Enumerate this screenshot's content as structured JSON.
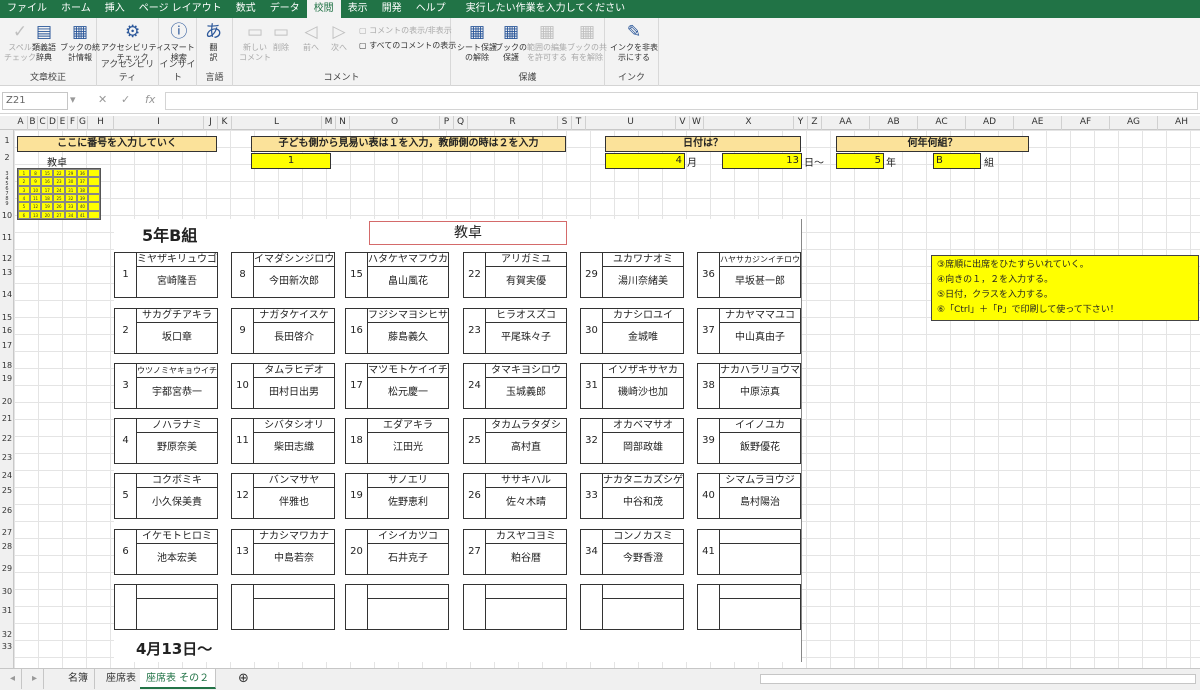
{
  "ribbon_tabs": [
    "ファイル",
    "ホーム",
    "挿入",
    "ページ レイアウト",
    "数式",
    "データ",
    "校閲",
    "表示",
    "開発",
    "ヘルプ",
    "実行したい作業を入力してください"
  ],
  "active_tab": "校閲",
  "groups": {
    "proofing": {
      "label": "文章校正",
      "spell": "スペル\nチェック",
      "thesaurus": "類義語\n辞典",
      "stats": "ブックの統\n計情報"
    },
    "accessibility": {
      "label": "アクセシビリティ",
      "check": "アクセシビリティ\nチェック"
    },
    "insights": {
      "label": "インサイト",
      "smart": "スマート\n検索"
    },
    "language": {
      "label": "言語",
      "translate": "翻\n訳"
    },
    "comments": {
      "label": "コメント",
      "new": "新しい\nコメント",
      "delete": "削除",
      "prev": "前へ",
      "next": "次へ",
      "show_hide": "コメントの表示/非表示",
      "show_all": "すべてのコメントの表示"
    },
    "protect": {
      "label": "保護",
      "unprotect_sheet": "シート保護\nの解除",
      "protect_book": "ブックの\n保護",
      "allow_edit": "範囲の編集\nを許可する",
      "unshare": "ブックの共\n有を解除"
    },
    "ink": {
      "label": "インク",
      "hide_ink": "インクを非表\n示にする"
    }
  },
  "namebox": "Z21",
  "columns": [
    "A",
    "B",
    "C",
    "D",
    "E",
    "F",
    "G",
    "H",
    "I",
    "J",
    "K",
    "L",
    "M",
    "N",
    "O",
    "P",
    "Q",
    "R",
    "S",
    "T",
    "U",
    "V",
    "W",
    "X",
    "Y",
    "Z",
    "AA",
    "AB",
    "AC",
    "AD",
    "AE",
    "AF",
    "AG",
    "AH"
  ],
  "rows": [
    "1",
    "2",
    "3",
    "4",
    "5",
    "6",
    "7",
    "8",
    "9",
    "10",
    "11",
    "12",
    "13",
    "14",
    "15",
    "16",
    "17",
    "18",
    "19",
    "20",
    "21",
    "22",
    "23",
    "24",
    "25",
    "26",
    "27",
    "28",
    "29",
    "30",
    "31",
    "32",
    "33"
  ],
  "header_bars": {
    "input_number": "ここに番号を入力していく",
    "view_side": "子ども側から見易い表は１を入力，教師側の時は２を入力",
    "date_q": "日付は？",
    "class_q": "何年何組？"
  },
  "values": {
    "view_side": "1",
    "month": "4",
    "month_unit": "月",
    "day": "13",
    "day_unit": "日～",
    "grade": "5",
    "grade_unit": "年",
    "class": "B",
    "class_unit": "組",
    "teacher_small": "教卓"
  },
  "mini_table": [
    "1",
    "8",
    "15",
    "22",
    "29",
    "36",
    "",
    "2",
    "9",
    "16",
    "23",
    "30",
    "37",
    "",
    "3",
    "10",
    "17",
    "24",
    "31",
    "38",
    "",
    "4",
    "11",
    "18",
    "25",
    "32",
    "39",
    "",
    "5",
    "12",
    "19",
    "26",
    "33",
    "40",
    "",
    "6",
    "13",
    "20",
    "27",
    "34",
    "41",
    ""
  ],
  "class_title": "5年B組",
  "teacher_desk": "教卓",
  "date_label": "4月13日～",
  "seats": [
    {
      "num": "1",
      "kana": "ミヤザキリュウゴ",
      "name": "宮崎隆吾"
    },
    {
      "num": "8",
      "kana": "イマダシンジロウ",
      "name": "今田新次郎"
    },
    {
      "num": "15",
      "kana": "ハタケヤマフウカ",
      "name": "畠山風花"
    },
    {
      "num": "22",
      "kana": "アリガミユ",
      "name": "有賀実優"
    },
    {
      "num": "29",
      "kana": "ユカワナオミ",
      "name": "湯川奈緒美"
    },
    {
      "num": "36",
      "kana": "ハヤサカジンイチロウ",
      "name": "早坂甚一郎"
    },
    {
      "num": "2",
      "kana": "サカグチアキラ",
      "name": "坂口章"
    },
    {
      "num": "9",
      "kana": "ナガタケイスケ",
      "name": "長田啓介"
    },
    {
      "num": "16",
      "kana": "フジシマヨシヒサ",
      "name": "藤島義久"
    },
    {
      "num": "23",
      "kana": "ヒラオスズコ",
      "name": "平尾珠々子"
    },
    {
      "num": "30",
      "kana": "カナシロユイ",
      "name": "金城唯"
    },
    {
      "num": "37",
      "kana": "ナカヤママユコ",
      "name": "中山真由子"
    },
    {
      "num": "3",
      "kana": "ウツノミヤキョウイチ",
      "name": "宇都宮恭一"
    },
    {
      "num": "10",
      "kana": "タムラヒデオ",
      "name": "田村日出男"
    },
    {
      "num": "17",
      "kana": "マツモトケイイチ",
      "name": "松元慶一"
    },
    {
      "num": "24",
      "kana": "タマキヨシロウ",
      "name": "玉城義郎"
    },
    {
      "num": "31",
      "kana": "イソザキサヤカ",
      "name": "磯崎沙也加"
    },
    {
      "num": "38",
      "kana": "ナカハラリョウマ",
      "name": "中原涼真"
    },
    {
      "num": "4",
      "kana": "ノハラナミ",
      "name": "野原奈美"
    },
    {
      "num": "11",
      "kana": "シバタシオリ",
      "name": "柴田志織"
    },
    {
      "num": "18",
      "kana": "エダアキラ",
      "name": "江田光"
    },
    {
      "num": "25",
      "kana": "タカムラタダシ",
      "name": "高村直"
    },
    {
      "num": "32",
      "kana": "オカベマサオ",
      "name": "岡部政雄"
    },
    {
      "num": "39",
      "kana": "イイノユカ",
      "name": "飯野優花"
    },
    {
      "num": "5",
      "kana": "コクボミキ",
      "name": "小久保美貴"
    },
    {
      "num": "12",
      "kana": "バンマサヤ",
      "name": "伴雅也"
    },
    {
      "num": "19",
      "kana": "サノエリ",
      "name": "佐野恵利"
    },
    {
      "num": "26",
      "kana": "ササキハル",
      "name": "佐々木晴"
    },
    {
      "num": "33",
      "kana": "ナカタニカズシゲ",
      "name": "中谷和茂"
    },
    {
      "num": "40",
      "kana": "シマムラヨウジ",
      "name": "島村陽治"
    },
    {
      "num": "6",
      "kana": "イケモトヒロミ",
      "name": "池本宏美"
    },
    {
      "num": "13",
      "kana": "ナカシマワカナ",
      "name": "中島若奈"
    },
    {
      "num": "20",
      "kana": "イシイカツコ",
      "name": "石井克子"
    },
    {
      "num": "27",
      "kana": "カスヤコヨミ",
      "name": "粕谷暦"
    },
    {
      "num": "34",
      "kana": "コンノカスミ",
      "name": "今野香澄"
    },
    {
      "num": "41",
      "kana": "",
      "name": ""
    },
    {
      "num": "",
      "kana": "",
      "name": ""
    },
    {
      "num": "",
      "kana": "",
      "name": ""
    },
    {
      "num": "",
      "kana": "",
      "name": ""
    },
    {
      "num": "",
      "kana": "",
      "name": ""
    },
    {
      "num": "",
      "kana": "",
      "name": ""
    },
    {
      "num": "",
      "kana": "",
      "name": ""
    }
  ],
  "notes": [
    "③席順に出席をひたすらいれていく。",
    "④向きの１，２を入力する。",
    "⑤日付，クラスを入力する。",
    "⑥「Ctrl」＋「P」で印刷して使って下さい！"
  ],
  "sheet_tabs": [
    "名簿",
    "座席表",
    "座席表 その２"
  ],
  "active_sheet": "座席表 その２"
}
